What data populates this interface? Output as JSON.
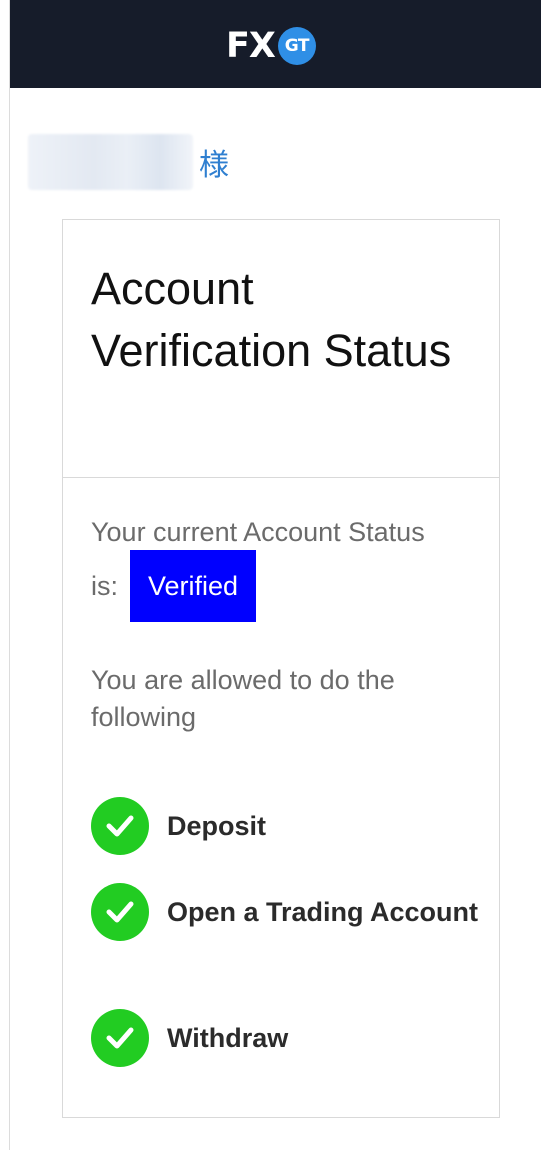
{
  "header": {
    "logo_text": "FX",
    "logo_badge": "GT"
  },
  "greeting": {
    "honorific": "様"
  },
  "card": {
    "title": "Account Verification Status",
    "status_prefix": "Your current Account Status",
    "status_is": "is:",
    "status_value": "Verified",
    "allowed_text": "You are allowed to do the following",
    "permissions": [
      {
        "label": "Deposit",
        "icon": "check-circle-icon"
      },
      {
        "label": "Open a Trading Account",
        "icon": "check-circle-icon"
      },
      {
        "label": "Withdraw",
        "icon": "check-circle-icon"
      }
    ]
  },
  "colors": {
    "header_bg": "#161c2a",
    "badge_blue": "#2f8fe6",
    "verified_bg": "#0000ff",
    "check_green": "#22cc22",
    "honorific_blue": "#2f7fd0"
  }
}
